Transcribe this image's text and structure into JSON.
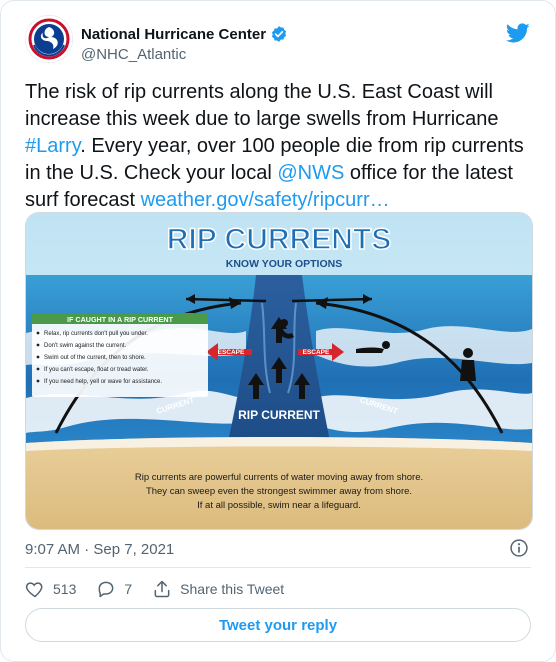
{
  "tweet": {
    "author_name": "National Hurricane Center",
    "author_handle": "@NHC_Atlantic",
    "avatar_text": "National Hurricane Center",
    "text_before_hashtag": "The risk of rip currents along the U.S. East Coast will increase this week due to large swells from Hurricane ",
    "hashtag": "#Larry",
    "text_middle": ". Every year, over 100 people die from rip currents in the U.S. Check your local ",
    "mention": "@NWS",
    "text_after_mention": " office for the latest surf forecast ",
    "link_text": "weather.gov/safety/ripcurr…",
    "timestamp": "9:07 AM · Sep 7, 2021",
    "likes": "513",
    "replies": "7",
    "share_label": "Share this Tweet",
    "reply_button": "Tweet your reply"
  },
  "infographic": {
    "title": "RIP CURRENTS",
    "subtitle": "KNOW YOUR OPTIONS",
    "panel_title": "IF CAUGHT IN A RIP CURRENT",
    "tips": [
      "Relax, rip currents don't pull you under.",
      "Don't swim against the current.",
      "Swim out of the current, then to shore.",
      "If you can't escape, float or tread water.",
      "If you need help, yell or wave for assistance."
    ],
    "escape_left": "ESCAPE",
    "escape_right": "ESCAPE",
    "current_left": "CURRENT",
    "current_right": "CURRENT",
    "rip_label": "RIP CURRENT",
    "bottom_line1": "Rip currents are powerful currents of water moving away from shore.",
    "bottom_line2": "They can sweep even the strongest swimmer away from shore.",
    "bottom_line3": "If at all possible, swim near a lifeguard."
  },
  "colors": {
    "accent": "#1d9bf0",
    "muted": "#536471",
    "verified": "#1d9bf0",
    "escape_red": "#d7262b",
    "panel_green": "#4a9a4a"
  },
  "icons": [
    "verified-badge-icon",
    "twitter-bird-icon",
    "info-icon",
    "heart-icon",
    "reply-icon",
    "share-icon"
  ]
}
